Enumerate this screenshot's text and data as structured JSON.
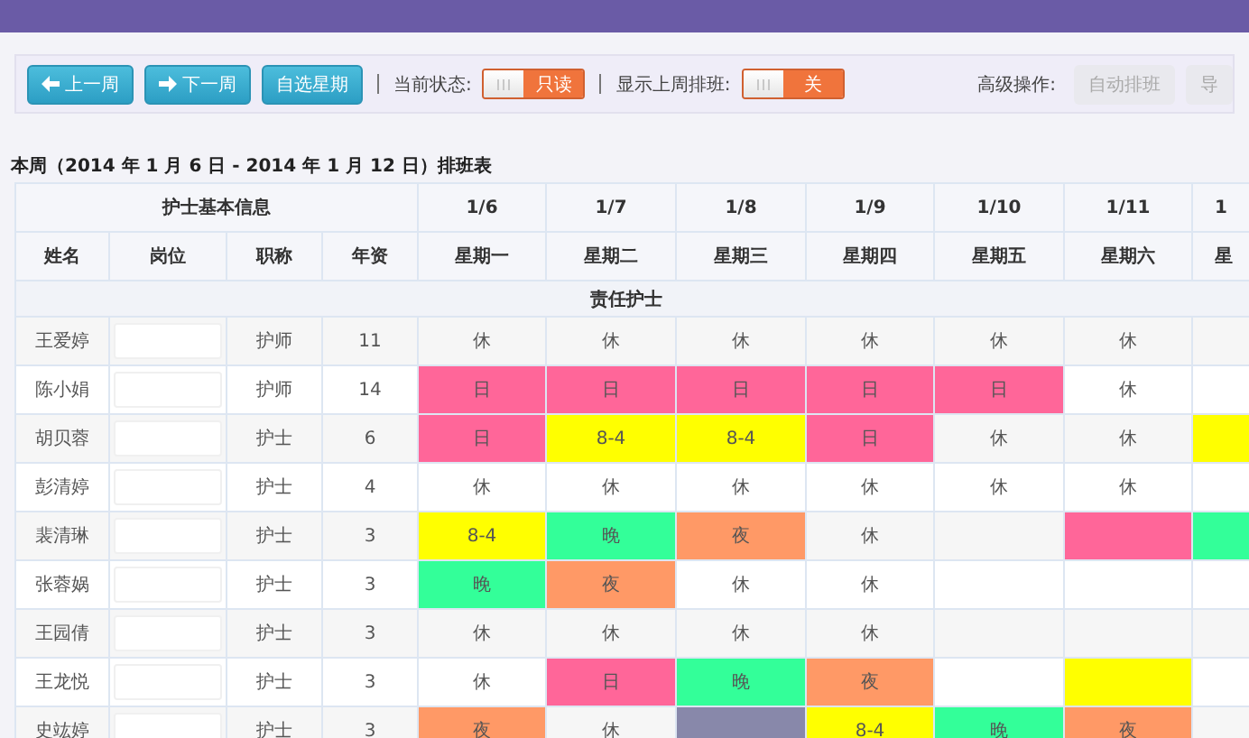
{
  "toolbar": {
    "nav_buttons": [
      {
        "label": "上一周",
        "kind": "prev"
      },
      {
        "label": "下一周",
        "kind": "next"
      },
      {
        "label": "自选星期",
        "kind": "plain"
      }
    ],
    "toggles": [
      {
        "label": "当前状态:",
        "value": "只读",
        "on": false
      },
      {
        "label": "显示上周排班:",
        "value": "关",
        "on": false
      }
    ],
    "advanced_label": "高级操作:",
    "advanced_buttons": [
      {
        "label": "自动排班",
        "disabled": true
      },
      {
        "label": "导",
        "disabled": true
      }
    ]
  },
  "schedule_title": "本周（2014 年 1 月 6 日 - 2014 年 1 月 12 日）排班表",
  "table": {
    "info_header": "护士基本信息",
    "info_columns": [
      "姓名",
      "岗位",
      "职称",
      "年资"
    ],
    "days": [
      {
        "date": "1/6",
        "weekday": "星期一"
      },
      {
        "date": "1/7",
        "weekday": "星期二"
      },
      {
        "date": "1/8",
        "weekday": "星期三"
      },
      {
        "date": "1/9",
        "weekday": "星期四"
      },
      {
        "date": "1/10",
        "weekday": "星期五"
      },
      {
        "date": "1/11",
        "weekday": "星期六"
      },
      {
        "date": "1",
        "weekday": "星"
      }
    ],
    "group": "责任护士",
    "rows": [
      {
        "name": "王爱婷",
        "title": "护师",
        "years": "11",
        "cells": [
          {
            "text": "休"
          },
          {
            "text": "休"
          },
          {
            "text": "休"
          },
          {
            "text": "休"
          },
          {
            "text": "休"
          },
          {
            "text": "休"
          },
          {}
        ]
      },
      {
        "name": "陈小娟",
        "title": "护师",
        "years": "14",
        "cells": [
          {
            "text": "日",
            "color": "#ff6699"
          },
          {
            "text": "日",
            "color": "#ff6699"
          },
          {
            "text": "日",
            "color": "#ff6699"
          },
          {
            "text": "日",
            "color": "#ff6699"
          },
          {
            "text": "日",
            "color": "#ff6699"
          },
          {
            "text": "休"
          },
          {}
        ]
      },
      {
        "name": "胡贝蓉",
        "title": "护士",
        "years": "6",
        "cells": [
          {
            "text": "日",
            "color": "#ff6699"
          },
          {
            "text": "8-4",
            "color": "#ffff00"
          },
          {
            "text": "8-4",
            "color": "#ffff00"
          },
          {
            "text": "日",
            "color": "#ff6699"
          },
          {
            "text": "休"
          },
          {
            "text": "休"
          },
          {
            "color": "#ffff00"
          }
        ]
      },
      {
        "name": "彭清婷",
        "title": "护士",
        "years": "4",
        "cells": [
          {
            "text": "休"
          },
          {
            "text": "休"
          },
          {
            "text": "休"
          },
          {
            "text": "休"
          },
          {
            "text": "休"
          },
          {
            "text": "休"
          },
          {}
        ]
      },
      {
        "name": "裴清琳",
        "title": "护士",
        "years": "3",
        "cells": [
          {
            "text": "8-4",
            "color": "#ffff00"
          },
          {
            "text": "晚",
            "color": "#33ff99"
          },
          {
            "text": "夜",
            "color": "#ff9966"
          },
          {
            "text": "休"
          },
          {},
          {
            "color": "#ff6699"
          },
          {
            "color": "#33ff99"
          }
        ]
      },
      {
        "name": "张蓉娲",
        "title": "护士",
        "years": "3",
        "cells": [
          {
            "text": "晚",
            "color": "#33ff99"
          },
          {
            "text": "夜",
            "color": "#ff9966"
          },
          {
            "text": "休"
          },
          {
            "text": "休"
          },
          {},
          {},
          {}
        ]
      },
      {
        "name": "王园倩",
        "title": "护士",
        "years": "3",
        "cells": [
          {
            "text": "休"
          },
          {
            "text": "休"
          },
          {
            "text": "休"
          },
          {
            "text": "休"
          },
          {},
          {},
          {}
        ]
      },
      {
        "name": "王龙悦",
        "title": "护士",
        "years": "3",
        "cells": [
          {
            "text": "休"
          },
          {
            "text": "日",
            "color": "#ff6699"
          },
          {
            "text": "晚",
            "color": "#33ff99"
          },
          {
            "text": "夜",
            "color": "#ff9966"
          },
          {},
          {
            "color": "#ffff00"
          },
          {}
        ]
      },
      {
        "name": "史竑婷",
        "title": "护士",
        "years": "3",
        "cells": [
          {
            "text": "夜",
            "color": "#ff9966"
          },
          {
            "text": "休"
          },
          {
            "color": "#8888aa"
          },
          {
            "text": "8-4",
            "color": "#ffff00"
          },
          {
            "text": "晚",
            "color": "#33ff99"
          },
          {
            "text": "夜",
            "color": "#ff9966"
          },
          {}
        ]
      }
    ]
  }
}
